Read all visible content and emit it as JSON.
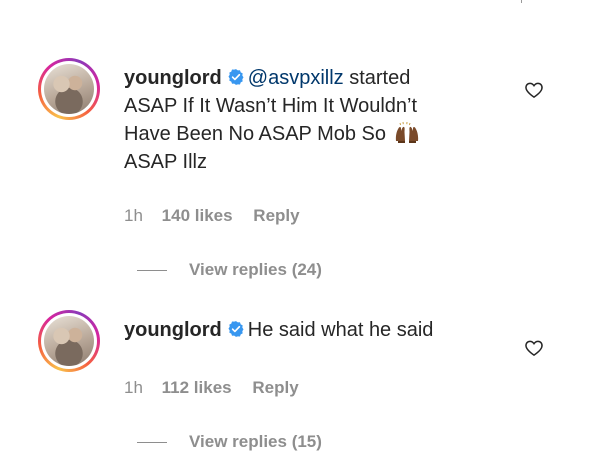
{
  "comments": [
    {
      "username": "younglord",
      "mention": "@asvpxillz",
      "text_line1_rest": " started",
      "text_lines": [
        "ASAP If It Wasn’t Him It Wouldn’t",
        "Have Been No ASAP Mob So"
      ],
      "text_last": "ASAP Illz",
      "time": "1h",
      "likes": "140 likes",
      "reply": "Reply",
      "view_replies": "View replies (24)",
      "emoji": "raised-hands-emoji"
    },
    {
      "username": "younglord",
      "text": "He said what he said",
      "time": "1h",
      "likes": "112 likes",
      "reply": "Reply",
      "view_replies": "View replies (15)"
    }
  ],
  "colors": {
    "verified": "#3897f0",
    "text": "#262626",
    "secondary": "#8e8e8e",
    "mention": "#00376b"
  },
  "icons": {
    "verified": "verified-badge-icon",
    "like": "heart-outline-icon"
  }
}
